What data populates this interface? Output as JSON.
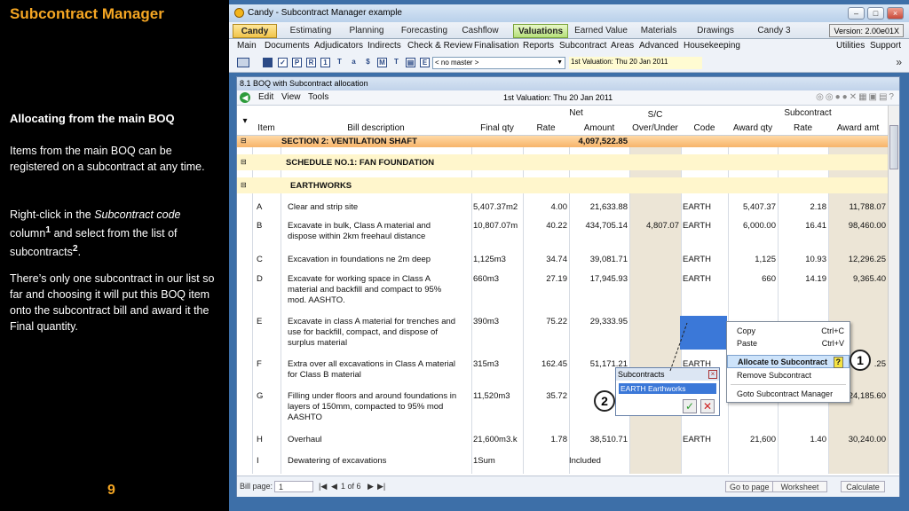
{
  "slide": {
    "title": "Subcontract Manager",
    "heading": "Allocating from the main BOQ",
    "p1": "Items from the main BOQ can be registered on a subcontract at any time.",
    "p2_a": "Right-click in the ",
    "p2_b": "Subcontract code",
    "p2_c": " column",
    "p2_sup1": "1",
    "p2_d": " and select from the list of subcontracts",
    "p2_sup2": "2",
    "p2_e": ".",
    "p3": "There’s only one subcontract in our list so far and choosing it will put this BOQ item onto the subcontract bill and award it the Final quantity.",
    "page_number": "9"
  },
  "window": {
    "title": "Candy - Subcontract Manager example",
    "version": "Version: 2.00e01X",
    "tabs": [
      "Candy",
      "Estimating",
      "Planning",
      "Forecasting",
      "Cashflow",
      "Valuations",
      "Earned Value",
      "Materials",
      "Drawings",
      "Candy 3"
    ],
    "menu": [
      "Main",
      "Documents",
      "Adjudicators",
      "Indirects",
      "Check & Review",
      "Finalisation",
      "Reports",
      "Subcontract",
      "Areas",
      "Advanced",
      "Housekeeping"
    ],
    "menu_right": [
      "Utilities",
      "Support"
    ],
    "master_select": "< no master >",
    "valuation_field": "1st Valuation: Thu 20 Jan 2011"
  },
  "subwindow": {
    "title": "8.1 BOQ with Subcontract allocation",
    "menu": [
      "Edit",
      "View",
      "Tools"
    ],
    "valuation": "1st Valuation: Thu 20 Jan 2011",
    "group_headers": {
      "net": "Net",
      "sc": "S/C",
      "subcontract": "Subcontract"
    },
    "columns": [
      "Item",
      "Bill description",
      "Final qty",
      "Rate",
      "Amount",
      "Over/Under",
      "Code",
      "Award qty",
      "Rate",
      "Award amt"
    ],
    "section_row": {
      "desc": "SECTION 2: VENTILATION SHAFT",
      "amount": "4,097,522.85"
    },
    "schedule_row": {
      "desc": "SCHEDULE NO.1: FAN FOUNDATION"
    },
    "earthworks_row": {
      "desc": "EARTHWORKS"
    },
    "rows": [
      {
        "item": "A",
        "desc1": "Clear and strip site",
        "desc2": "",
        "desc3": "",
        "qty": "5,407.37m2",
        "rate": "4.00",
        "amount": "21,633.88",
        "over": "",
        "code": "EARTH",
        "award_qty": "5,407.37",
        "sc_rate": "2.18",
        "award_amt": "11,788.07"
      },
      {
        "item": "B",
        "desc1": "Excavate in bulk, Class A material and",
        "desc2": "dispose within 2km freehaul distance",
        "desc3": "",
        "qty": "10,807.07m",
        "rate": "40.22",
        "amount": "434,705.14",
        "over": "4,807.07",
        "code": "EARTH",
        "award_qty": "6,000.00",
        "sc_rate": "16.41",
        "award_amt": "98,460.00"
      },
      {
        "item": "C",
        "desc1": "Excavation in foundations ne 2m deep",
        "desc2": "",
        "desc3": "",
        "qty": "1,125m3",
        "rate": "34.74",
        "amount": "39,081.71",
        "over": "",
        "code": "EARTH",
        "award_qty": "1,125",
        "sc_rate": "10.93",
        "award_amt": "12,296.25"
      },
      {
        "item": "D",
        "desc1": "Excavate for working space in Class A",
        "desc2": "material and backfill and compact to 95%",
        "desc3": "mod. AASHTO.",
        "qty": "660m3",
        "rate": "27.19",
        "amount": "17,945.93",
        "over": "",
        "code": "EARTH",
        "award_qty": "660",
        "sc_rate": "14.19",
        "award_amt": "9,365.40"
      },
      {
        "item": "E",
        "desc1": "Excavate in class A material for trenches and",
        "desc2": "use for backfill, compact, and dispose of",
        "desc3": "surplus material",
        "qty": "390m3",
        "rate": "75.22",
        "amount": "29,333.95",
        "over": "",
        "code": "",
        "award_qty": "",
        "sc_rate": "",
        "award_amt": ""
      },
      {
        "item": "F",
        "desc1": "Extra over all excavations in Class A material",
        "desc2": "for Class B material",
        "desc3": "",
        "qty": "315m3",
        "rate": "162.45",
        "amount": "51,171.21",
        "over": "",
        "code": "EARTH",
        "award_qty": "",
        "sc_rate": "",
        "award_amt": ".25"
      },
      {
        "item": "G",
        "desc1": "Filling under floors and around foundations in",
        "desc2": "layers of 150mm, compacted to 95% mod",
        "desc3": "AASHTO",
        "qty": "11,520m3",
        "rate": "35.72",
        "amount": "41",
        "over": "",
        "code": "",
        "award_qty": "",
        "sc_rate": "",
        "award_amt": "24,185.60"
      },
      {
        "item": "H",
        "desc1": "Overhaul",
        "desc2": "",
        "desc3": "",
        "qty": "21,600m3.k",
        "rate": "1.78",
        "amount": "38,510.71",
        "over": "",
        "code": "EARTH",
        "award_qty": "21,600",
        "sc_rate": "1.40",
        "award_amt": "30,240.00"
      },
      {
        "item": "I",
        "desc1": "Dewatering of excavations",
        "desc2": "",
        "desc3": "",
        "qty": "1Sum",
        "rate": "",
        "amount": "Included",
        "over": "",
        "code": "",
        "award_qty": "",
        "sc_rate": "",
        "award_amt": ""
      }
    ],
    "status": {
      "bill_page_label": "Bill page:",
      "bill_page_value": "1",
      "page_of": "1 of 6",
      "goto": "Go to page",
      "worksheet": "Worksheet",
      "calculate": "Calculate"
    }
  },
  "context_menu": {
    "copy": "Copy",
    "copy_sc": "Ctrl+C",
    "paste": "Paste",
    "paste_sc": "Ctrl+V",
    "allocate": "Allocate to Subcontract",
    "remove": "Remove Subcontract",
    "goto": "Goto Subcontract Manager"
  },
  "popup": {
    "title": "Subcontracts",
    "option": "EARTH     Earthworks"
  },
  "callouts": {
    "one": "1",
    "two": "2"
  }
}
